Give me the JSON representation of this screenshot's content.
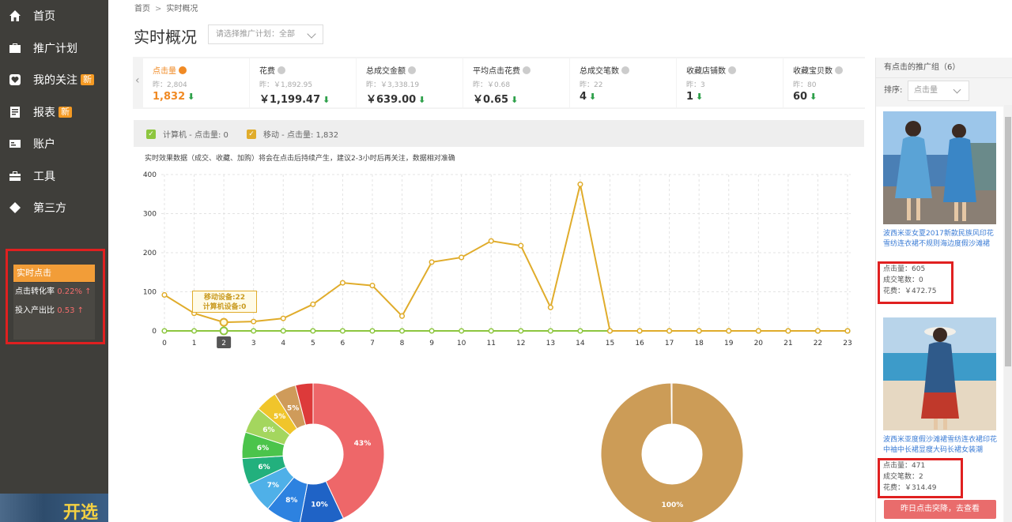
{
  "sidebar": {
    "items": [
      {
        "label": "首页",
        "icon": "home-icon",
        "badge": ""
      },
      {
        "label": "推广计划",
        "icon": "briefcase-icon",
        "badge": ""
      },
      {
        "label": "我的关注",
        "icon": "heart-icon",
        "badge": "新"
      },
      {
        "label": "报表",
        "icon": "report-icon",
        "badge": "新"
      },
      {
        "label": "账户",
        "icon": "account-card-icon",
        "badge": ""
      },
      {
        "label": "工具",
        "icon": "toolbox-icon",
        "badge": ""
      },
      {
        "label": "第三方",
        "icon": "diamond-icon",
        "badge": ""
      }
    ],
    "realtime": {
      "title": "实时点击",
      "conv_label": "点击转化率",
      "conv_value": "0.22%",
      "roi_label": "投入产出比",
      "roi_value": "0.53",
      "arrow": "↑"
    },
    "banner_text": "开选"
  },
  "breadcrumb": {
    "home": "首页",
    "sep": ">",
    "current": "实时概况"
  },
  "page_title": "实时概况",
  "plan_select": {
    "label": "请选择推广计划：",
    "value": "全部"
  },
  "metrics": [
    {
      "name": "点击量",
      "yesterday": "昨：2,804",
      "value": "1,832",
      "active": true
    },
    {
      "name": "花费",
      "yesterday": "昨：￥1,892.95",
      "value": "￥1,199.47",
      "active": false
    },
    {
      "name": "总成交金额",
      "yesterday": "昨：￥3,338.19",
      "value": "￥639.00",
      "active": false
    },
    {
      "name": "平均点击花费",
      "yesterday": "昨：￥0.68",
      "value": "￥0.65",
      "active": false
    },
    {
      "name": "总成交笔数",
      "yesterday": "昨：22",
      "value": "4",
      "active": false
    },
    {
      "name": "收藏店铺数",
      "yesterday": "昨：3",
      "value": "1",
      "active": false
    },
    {
      "name": "收藏宝贝数",
      "yesterday": "昨：80",
      "value": "60",
      "active": false
    }
  ],
  "legend": {
    "pc": "计算机 - 点击量: 0",
    "mobile": "移动 - 点击量: 1,832"
  },
  "note": "实时效果数据（成交、收藏、加购）将会在点击后持续产生，建议2-3小时后再关注，数据相对准确",
  "colors": {
    "mobile": "#e0ac2b",
    "pc": "#8dc63f",
    "accent": "#f08a24",
    "alert": "#e02020"
  },
  "tooltip": {
    "line1": "移动设备:22",
    "line2": "计算机设备:0"
  },
  "chart_data": [
    {
      "type": "line",
      "x": [
        "0",
        "1",
        "2",
        "3",
        "4",
        "5",
        "6",
        "7",
        "8",
        "9",
        "10",
        "11",
        "12",
        "13",
        "14",
        "15",
        "16",
        "17",
        "18",
        "19",
        "20",
        "21",
        "22",
        "23"
      ],
      "ylim": [
        0,
        400
      ],
      "yticks": [
        0,
        100,
        200,
        300,
        400
      ],
      "grid": true,
      "highlight_x": "2",
      "series": [
        {
          "name": "移动",
          "color": "#e0ac2b",
          "values": [
            92,
            45,
            22,
            24,
            32,
            68,
            123,
            116,
            38,
            176,
            188,
            230,
            218,
            60,
            375,
            0,
            0,
            0,
            0,
            0,
            0,
            0,
            0,
            0
          ]
        },
        {
          "name": "计算机",
          "color": "#8dc63f",
          "values": [
            0,
            0,
            0,
            0,
            0,
            0,
            0,
            0,
            0,
            0,
            0,
            0,
            0,
            0,
            0,
            0,
            0,
            0,
            0,
            0,
            0,
            0,
            0,
            0
          ]
        }
      ]
    },
    {
      "type": "pie",
      "donut": true,
      "slices": [
        {
          "label": "43%",
          "value": 43,
          "color": "#ee6769"
        },
        {
          "label": "10%",
          "value": 10,
          "color": "#1f63c6"
        },
        {
          "label": "8%",
          "value": 8,
          "color": "#2d82e0"
        },
        {
          "label": "7%",
          "value": 7,
          "color": "#4fb0e8"
        },
        {
          "label": "6%",
          "value": 6,
          "color": "#22b07d"
        },
        {
          "label": "6%",
          "value": 6,
          "color": "#4bc44b"
        },
        {
          "label": "6%",
          "value": 6,
          "color": "#a4d65e"
        },
        {
          "label": "5%",
          "value": 5,
          "color": "#f0c52b"
        },
        {
          "label": "5%",
          "value": 5,
          "color": "#cf9b5a"
        },
        {
          "label": "4%",
          "value": 4,
          "color": "#dd3a3a"
        }
      ]
    },
    {
      "type": "pie",
      "donut": true,
      "slices": [
        {
          "label": "100%",
          "value": 100,
          "color": "#cc9c57"
        },
        {
          "label": "0%",
          "value": 0.2,
          "color": "#dd3a3a"
        }
      ]
    }
  ],
  "right_panel": {
    "title": "有点击的推广组（6）",
    "sort_label": "排序:",
    "sort_value": "点击量",
    "products": [
      {
        "title": "波西米亚女夏2017新款民族风印花雪纺连衣裙不规则海边度假沙滩裙",
        "clicks": "点击量：605",
        "orders": "成交笔数：0",
        "cost": "花费：￥472.75"
      },
      {
        "title": "波西米亚度假沙滩裙雪纺连衣裙印花中袖中长裙显瘦大码长裙女装潮",
        "clicks": "点击量：471",
        "orders": "成交笔数：2",
        "cost": "花费：￥314.49"
      }
    ],
    "cta": "昨日点击突降，去查看"
  }
}
